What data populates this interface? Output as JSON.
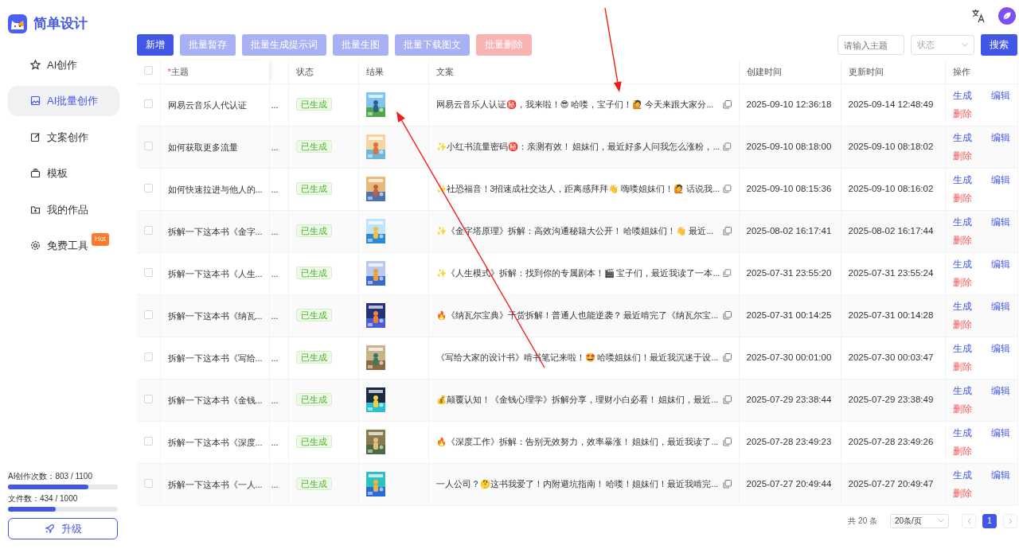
{
  "brand": {
    "name": "简单设计"
  },
  "sidebar": {
    "items": [
      {
        "label": "AI创作",
        "selected": false
      },
      {
        "label": "AI批量创作",
        "selected": true
      },
      {
        "label": "文案创作",
        "selected": false
      },
      {
        "label": "模板",
        "selected": false
      },
      {
        "label": "我的作品",
        "selected": false
      },
      {
        "label": "免费工具",
        "selected": false,
        "badge": "Hot"
      }
    ]
  },
  "usage": [
    {
      "label": "AI创作次数：803 / 1100",
      "level": 0.73
    },
    {
      "label": "文件数：434 / 1000",
      "level": 0.434
    }
  ],
  "upgrade_button": "升级",
  "toolbar": {
    "buttons": [
      {
        "label": "新增",
        "kind": "primary"
      },
      {
        "label": "批量暂存",
        "kind": "muted"
      },
      {
        "label": "批量生成提示词",
        "kind": "muted"
      },
      {
        "label": "批量生图",
        "kind": "muted"
      },
      {
        "label": "批量下载图文",
        "kind": "muted"
      },
      {
        "label": "批量删除",
        "kind": "danger"
      }
    ],
    "search": {
      "placeholder": "请输入主题"
    },
    "status_select": {
      "placeholder": "状态"
    },
    "search_button": "搜索"
  },
  "table": {
    "header_checked": false,
    "columns": [
      {
        "kind": "checkbox"
      },
      {
        "kind": "text",
        "label": "主题",
        "required_mark": "*"
      },
      {
        "kind": "cut"
      },
      {
        "kind": "text",
        "label": "状态"
      },
      {
        "kind": "text",
        "label": "结果"
      },
      {
        "kind": "text",
        "label": "文案"
      },
      {
        "kind": "text",
        "label": "创建时间"
      },
      {
        "kind": "text",
        "label": "更新时间"
      },
      {
        "kind": "text",
        "label": "操作"
      }
    ],
    "rows": [
      {
        "checked": false,
        "topic": "网易云音乐人代认证",
        "column_3": "...",
        "status": "已生成",
        "content": "网易云音乐人认证㊙️，我来啦！😎 哈喽，宝子们！🙋 今天来跟大家分...",
        "created": "2025-09-10 12:36:18",
        "updated": "2025-09-14 12:48:49",
        "actions": [
          "生成",
          "编辑",
          "删除"
        ]
      },
      {
        "checked": false,
        "topic": "如何获取更多流量",
        "column_3": "...",
        "status": "已生成",
        "content": "✨小红书流量密码㊙️：亲测有效！ 姐妹们，最近好多人问我怎么涨粉，...",
        "created": "2025-09-10 08:18:00",
        "updated": "2025-09-10 08:18:02",
        "actions": [
          "生成",
          "编辑",
          "删除"
        ]
      },
      {
        "checked": false,
        "topic": "如何快速拉进与他人的...",
        "column_3": "...",
        "status": "已生成",
        "content": "✨社恐福音！3招速成社交达人，距离感拜拜👋 嗨喽姐妹们！🙋 话说我...",
        "created": "2025-09-10 08:15:36",
        "updated": "2025-09-10 08:16:02",
        "actions": [
          "生成",
          "编辑",
          "删除"
        ]
      },
      {
        "checked": false,
        "topic": "拆解一下这本书《金字...",
        "column_3": "...",
        "status": "已生成",
        "content": "✨《金字塔原理》拆解：高效沟通秘籍大公开！ 哈喽姐妹们！👋 最近...",
        "created": "2025-08-02 16:17:41",
        "updated": "2025-08-02 16:17:44",
        "actions": [
          "生成",
          "编辑",
          "删除"
        ]
      },
      {
        "checked": false,
        "topic": "拆解一下这本书《人生...",
        "column_3": "...",
        "status": "已生成",
        "content": "✨《人生模式》拆解：找到你的专属剧本！🎬 宝子们，最近我读了一本...",
        "created": "2025-07-31 23:55:20",
        "updated": "2025-07-31 23:55:24",
        "actions": [
          "生成",
          "编辑",
          "删除"
        ]
      },
      {
        "checked": false,
        "topic": "拆解一下这本书《纳瓦...",
        "column_3": "...",
        "status": "已生成",
        "content": "🔥《纳瓦尔宝典》干货拆解！普通人也能逆袭？ 最近啃完了《纳瓦尔宝...",
        "created": "2025-07-31 00:14:25",
        "updated": "2025-07-31 00:14:28",
        "actions": [
          "生成",
          "编辑",
          "删除"
        ]
      },
      {
        "checked": false,
        "topic": "拆解一下这本书《写给...",
        "column_3": "...",
        "status": "已生成",
        "content": "《写给大家的设计书》啃书笔记来啦！🤩 哈喽姐妹们！最近我沉迷于设...",
        "created": "2025-07-30 00:01:00",
        "updated": "2025-07-30 00:03:47",
        "actions": [
          "生成",
          "编辑",
          "删除"
        ]
      },
      {
        "checked": false,
        "topic": "拆解一下这本书《金钱...",
        "column_3": "...",
        "status": "已生成",
        "content": "💰颠覆认知！《金钱心理学》拆解分享，理财小白必看！ 姐妹们，最近...",
        "created": "2025-07-29 23:38:44",
        "updated": "2025-07-29 23:38:49",
        "actions": [
          "生成",
          "编辑",
          "删除"
        ]
      },
      {
        "checked": false,
        "topic": "拆解一下这本书《深度...",
        "column_3": "...",
        "status": "已生成",
        "content": "🔥《深度工作》拆解：告别无效努力，效率暴涨！ 姐妹们，最近我读了...",
        "created": "2025-07-28 23:49:23",
        "updated": "2025-07-28 23:49:26",
        "actions": [
          "生成",
          "编辑",
          "删除"
        ]
      },
      {
        "checked": false,
        "topic": "拆解一下这本书《一人...",
        "column_3": "...",
        "status": "已生成",
        "content": "一人公司？🤔这书我爱了！内附避坑指南！ 哈喽！姐妹们！最近我啃完...",
        "created": "2025-07-27 20:49:44",
        "updated": "2025-07-27 20:49:47",
        "actions": [
          "生成",
          "编辑",
          "删除"
        ]
      }
    ]
  },
  "pagination": {
    "total": "共 20 条",
    "page_size": "20条/页",
    "pages": [
      {
        "label": "1",
        "selected": true
      }
    ]
  },
  "annotations": [
    {
      "kind": "arrow"
    },
    {
      "kind": "arrow"
    }
  ]
}
